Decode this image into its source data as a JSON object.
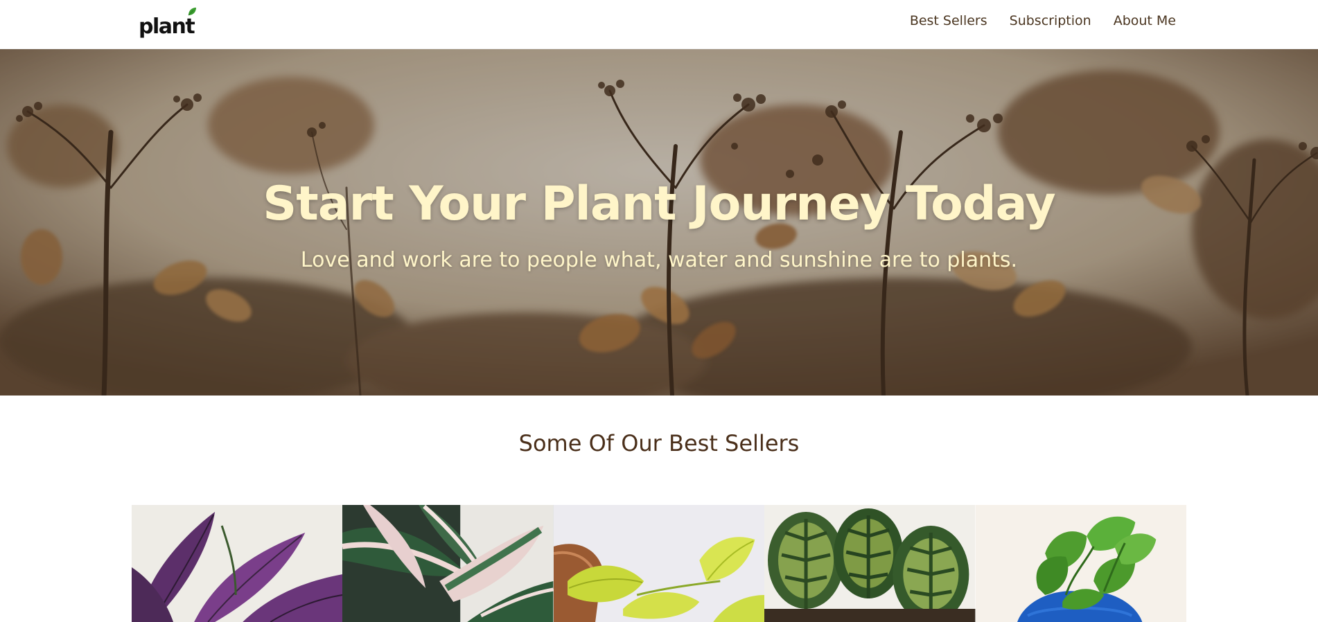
{
  "navbar": {
    "logo_text": "plant",
    "links": [
      {
        "label": "Best Sellers"
      },
      {
        "label": "Subscription"
      },
      {
        "label": "About Me"
      }
    ]
  },
  "hero": {
    "title": "Start Your Plant Journey Today",
    "subtitle": "Love and work are to people what, water and sunshine are to plants."
  },
  "best_sellers": {
    "title": "Some Of Our Best Sellers",
    "products": [
      {
        "image": "persian-shield-plant"
      },
      {
        "image": "stromanthe-triostar-plant"
      },
      {
        "image": "neon-pothos-plant"
      },
      {
        "image": "calathea-makoyana-plant"
      },
      {
        "image": "golden-pothos-plant"
      }
    ]
  },
  "colors": {
    "hero_text": "#fff5c9",
    "nav_text": "#4a3520",
    "section_title": "#4a2f1a",
    "logo_leaf": "#3a9d2f"
  }
}
